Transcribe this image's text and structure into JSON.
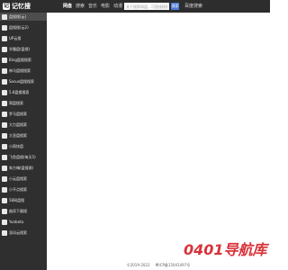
{
  "app": {
    "logo_text": "记忆搜",
    "logo_mark": "记"
  },
  "nav": {
    "items": [
      {
        "label": "网盘",
        "active": true
      },
      {
        "label": "搜索",
        "active": false
      },
      {
        "label": "音乐",
        "active": false
      },
      {
        "label": "电影",
        "active": false
      },
      {
        "label": "动漫",
        "active": false
      },
      {
        "label": "购物",
        "active": false
      }
    ]
  },
  "search": {
    "placeholder": "关于搜索网盘，可直接搜索",
    "button_label": "搜索",
    "secondary_link": "百度搜索"
  },
  "sidebar": {
    "items": [
      {
        "label": "盘搜搜(云)",
        "active": true
      },
      {
        "label": "盘搜搜(云2)",
        "active": false
      },
      {
        "label": "UP云搜",
        "active": false
      },
      {
        "label": "学霸盘(盘搜)",
        "active": false
      },
      {
        "label": "Bing盘搜搜索",
        "active": false
      },
      {
        "label": "神马盘搜搜索",
        "active": false
      },
      {
        "label": "Sosuo盘搜搜索",
        "active": false
      },
      {
        "label": "5.8盘搜搜索",
        "active": false
      },
      {
        "label": "简盘搜索",
        "active": false
      },
      {
        "label": "罗马盘搜索",
        "active": false
      },
      {
        "label": "大力盘搜索",
        "active": false
      },
      {
        "label": "大圣盘搜索",
        "active": false
      },
      {
        "label": "小雨快盘",
        "active": false
      },
      {
        "label": "飞鱼盘搜(每天5)",
        "active": false
      },
      {
        "label": "朱力嗨(盘搜源)",
        "active": false
      },
      {
        "label": "小云盘搜索",
        "active": false
      },
      {
        "label": "小不点搜索",
        "active": false
      },
      {
        "label": "58网盘搜",
        "active": false
      },
      {
        "label": "曲奇下载搜",
        "active": false
      },
      {
        "label": "Yunbeta",
        "active": false
      },
      {
        "label": "凌风云搜索",
        "active": false
      }
    ]
  },
  "watermark": {
    "text": "0401导航库"
  },
  "footer": {
    "copyright": "©2019-2022",
    "icp": "粤ICP备15041497号"
  },
  "colors": {
    "topbar": "#2d2d2d",
    "sidebar": "#2f2f2f",
    "accent": "#4a7ad6",
    "watermark": "#d8333a"
  }
}
